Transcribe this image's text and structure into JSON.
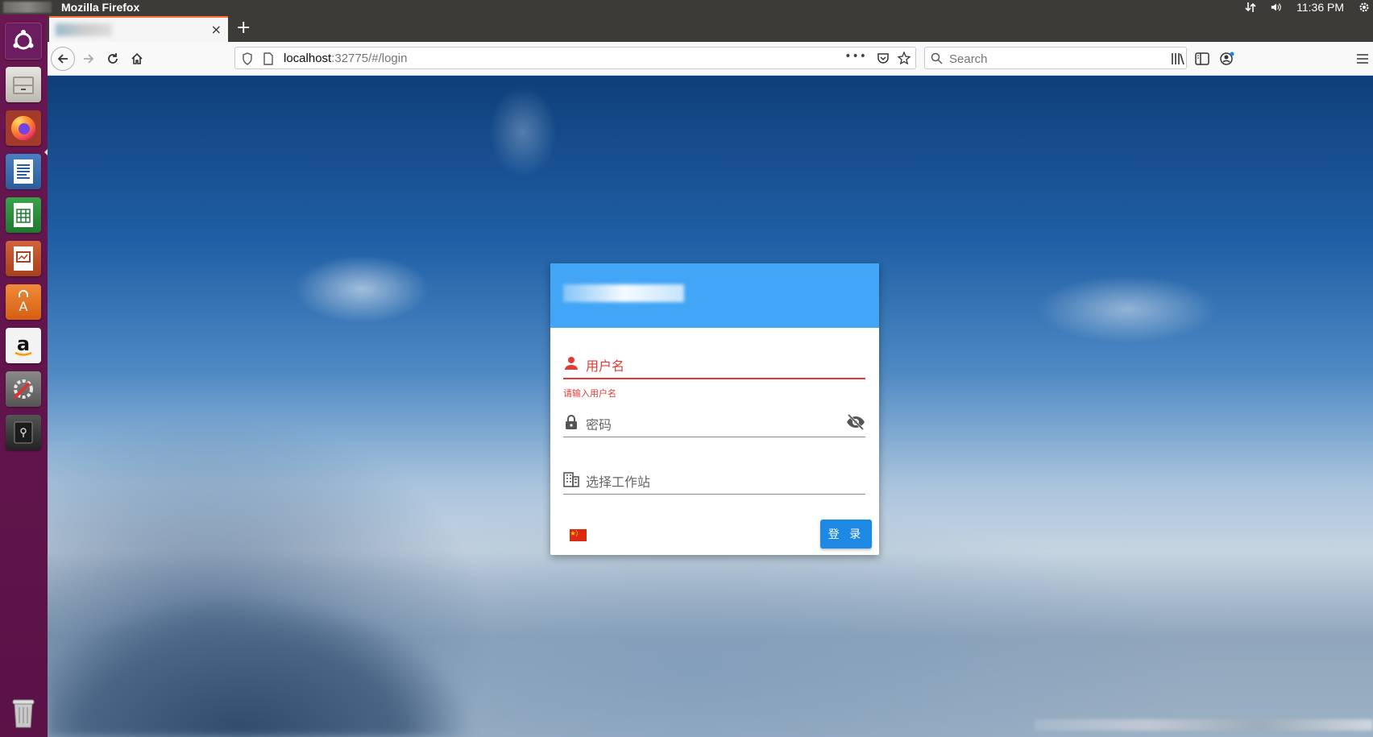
{
  "panel": {
    "app_title": "Mozilla Firefox",
    "clock": "11:36 PM"
  },
  "launcher": {
    "items": [
      {
        "name": "ubuntu-dash",
        "icon": "ubuntu-logo-icon"
      },
      {
        "name": "files",
        "icon": "file-cabinet-icon"
      },
      {
        "name": "firefox",
        "icon": "firefox-icon",
        "active": true
      },
      {
        "name": "writer",
        "icon": "writer-document-icon"
      },
      {
        "name": "calc",
        "icon": "spreadsheet-icon"
      },
      {
        "name": "impress",
        "icon": "presentation-icon"
      },
      {
        "name": "software",
        "icon": "shopping-bag-icon"
      },
      {
        "name": "amazon",
        "icon": "amazon-icon",
        "glyph": "a"
      },
      {
        "name": "settings",
        "icon": "wrench-gear-icon"
      },
      {
        "name": "safe",
        "icon": "safe-icon"
      },
      {
        "name": "trash",
        "icon": "trash-icon"
      }
    ]
  },
  "browser": {
    "url_host": "localhost",
    "url_path": ":32775/#/login",
    "search_placeholder": "Search",
    "new_tab_label": "+",
    "close_tab_label": "×",
    "page_actions_label": "•••"
  },
  "login": {
    "username_label": "用户名",
    "username_error": "请输入用户名",
    "password_label": "密码",
    "workstation_label": "选择工作站",
    "login_button": "登 录"
  },
  "colors": {
    "header_blue": "#42a5f5",
    "button_blue": "#1e88e5",
    "error_red": "#e53935",
    "launcher_purple": "#6a1752"
  }
}
